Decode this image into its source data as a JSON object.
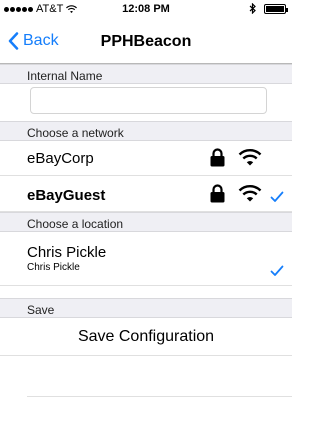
{
  "status_bar": {
    "carrier": "AT&T",
    "time": "12:08 PM"
  },
  "nav": {
    "back_label": "Back",
    "title": "PPHBeacon"
  },
  "internal_name": {
    "header": "Internal Name",
    "value": ""
  },
  "network": {
    "header": "Choose a network",
    "items": [
      {
        "label": "eBayCorp",
        "secured": true,
        "selected": false
      },
      {
        "label": "eBayGuest",
        "secured": true,
        "selected": true
      }
    ]
  },
  "location": {
    "header": "Choose a location",
    "title": "Chris Pickle",
    "subtitle": "Chris Pickle",
    "selected": true
  },
  "save": {
    "header": "Save",
    "button_label": "Save Configuration"
  },
  "colors": {
    "accent": "#157efb",
    "section_background": "#efeff4"
  },
  "icons": [
    "back-chevron-icon",
    "wifi-icon",
    "bluetooth-icon",
    "battery-icon",
    "lock-icon",
    "checkmark-icon"
  ]
}
